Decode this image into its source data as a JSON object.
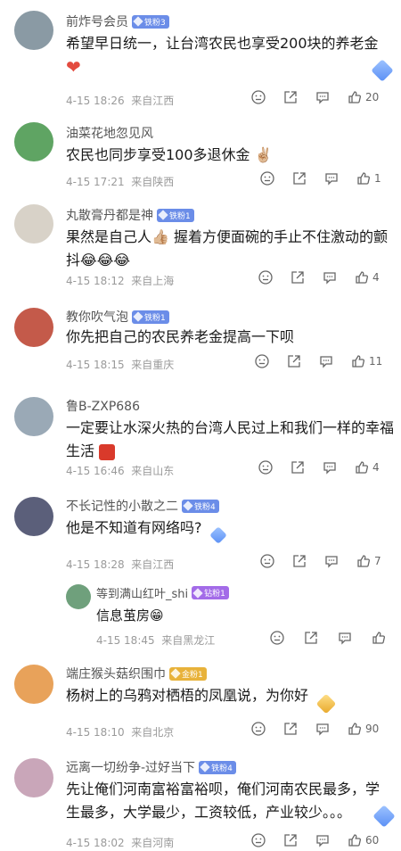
{
  "comments": [
    {
      "username": "前炸号会员",
      "badge": "铁粉3",
      "text_line1": "希望早日统一，让台湾农民也享受200块的养老金",
      "emoji": "heart",
      "date": "4-15 18:26",
      "location": "来自江西",
      "like_count": "20",
      "avatar_color": "#8a9aa4"
    },
    {
      "username": "油菜花地忽见风",
      "badge": "",
      "text_line1": "农民也同步享受100多退休金",
      "emoji_glyph": "✌🏼",
      "date": "4-15 17:21",
      "location": "来自陕西",
      "like_count": "1",
      "avatar_color": "#5fa463"
    },
    {
      "username": "丸散膏丹都是神",
      "badge": "铁粉1",
      "text_line1": "果然是自己人👍🏼 握着方便面碗的手止不住激动的颤",
      "text_line2": "抖😂😂😂",
      "date": "4-15 18:12",
      "location": "来自上海",
      "like_count": "4",
      "avatar_color": "#d8d2c8"
    },
    {
      "username": "教你吹气泡",
      "badge": "铁粉1",
      "text_line1": "你先把自己的农民养老金提高一下呗",
      "date": "4-15 18:15",
      "location": "来自重庆",
      "like_count": "11",
      "avatar_color": "#c45a4a"
    },
    {
      "username": "鲁B-ZXP686",
      "badge": "",
      "text_line1": "一定要让水深火热的台湾人民过上和我们一样的幸福",
      "text_line2": "生活",
      "date": "4-15 16:46",
      "location": "来自山东",
      "like_count": "4",
      "avatar_color": "#9aa9b6"
    },
    {
      "username": "不长记性的小散之二",
      "badge": "铁粉4",
      "text_line1": "他是不知道有网络吗?",
      "date": "4-15 18:28",
      "location": "来自江西",
      "like_count": "7",
      "avatar_color": "#5b5f7a"
    },
    {
      "username": "等到满山红叶_shi",
      "badge": "钻粉1",
      "text_line1": "信息茧房😁",
      "date": "4-15 18:45",
      "location": "来自黑龙江",
      "like_count": "",
      "avatar_color": "#6fa07c"
    },
    {
      "username": "端庄猴头菇织围巾",
      "badge": "金粉1",
      "text_line1": "杨树上的乌鸦对栖梧的凤凰说，为你好",
      "date": "4-15 18:10",
      "location": "来自北京",
      "like_count": "90",
      "avatar_color": "#e8a25a"
    },
    {
      "username": "远离一切纷争-过好当下",
      "badge": "铁粉4",
      "text_line1": "先让俺们河南富裕富裕呗，俺们河南农民最多，学",
      "text_line2": "生最多，大学最少，工资较低，产业较少。。。",
      "date": "4-15 18:02",
      "location": "来自河南",
      "like_count": "60",
      "avatar_color": "#c9a6b9"
    }
  ]
}
